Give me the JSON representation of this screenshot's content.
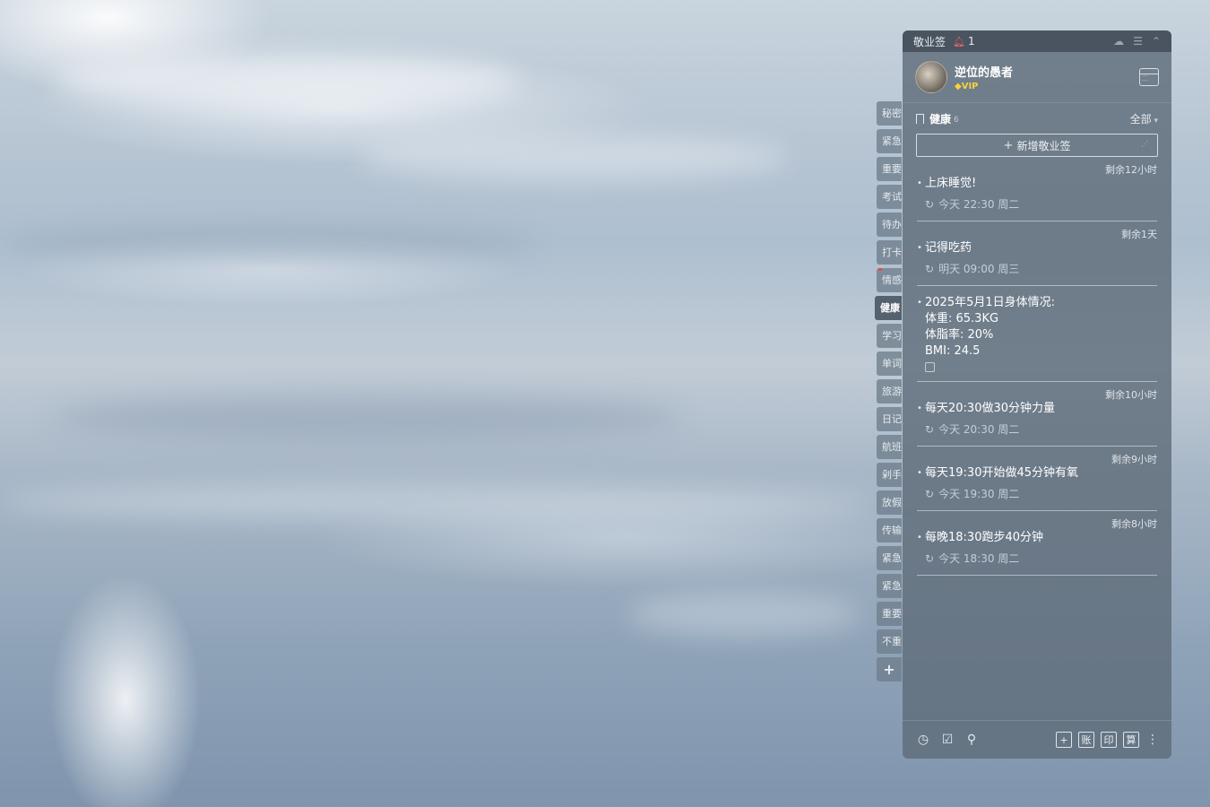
{
  "titlebar": {
    "app_name": "敬业签",
    "notify_count": "1",
    "icons": [
      "cloud-icon",
      "menu-icon",
      "collapse-icon"
    ]
  },
  "profile": {
    "username": "逆位的愚者",
    "vip_label": "VIP"
  },
  "tags": [
    {
      "label": "秘密"
    },
    {
      "label": "紧急"
    },
    {
      "label": "重要"
    },
    {
      "label": "考试"
    },
    {
      "label": "待办"
    },
    {
      "label": "打卡"
    },
    {
      "label": "情感"
    },
    {
      "label": "健康"
    },
    {
      "label": "学习"
    },
    {
      "label": "单词"
    },
    {
      "label": "旅游"
    },
    {
      "label": "日记"
    },
    {
      "label": "航班"
    },
    {
      "label": "剁手"
    },
    {
      "label": "放假"
    },
    {
      "label": "传输"
    },
    {
      "label": "紧急"
    },
    {
      "label": "紧急"
    },
    {
      "label": "重要"
    },
    {
      "label": "不重"
    }
  ],
  "add_tag_label": "+",
  "category": {
    "title": "健康",
    "count": "6",
    "filter": "全部"
  },
  "new_note_label": "新增敬业签",
  "notes": [
    {
      "remain": "剩余12小时",
      "text": "上床睡觉!",
      "time": "今天 22:30 周二"
    },
    {
      "remain": "剩余1天",
      "text": "记得吃药",
      "time": "明天 09:00 周三"
    },
    {
      "remain": "",
      "text": "2025年5月1日身体情况:\n体重: 65.3KG\n体脂率: 20%\nBMI: 24.5",
      "time": ""
    },
    {
      "remain": "剩余10小时",
      "text": "每天20:30做30分钟力量",
      "time": "今天 20:30 周二"
    },
    {
      "remain": "剩余9小时",
      "text": "每天19:30开始做45分钟有氧",
      "time": "今天 19:30 周二"
    },
    {
      "remain": "剩余8小时",
      "text": "每晚18:30跑步40分钟",
      "time": "今天 18:30 周二"
    }
  ],
  "bottom": {
    "left_icons": [
      "clock-icon",
      "calendar-check-icon",
      "search-icon"
    ],
    "buttons": [
      "+",
      "账",
      "印",
      "算"
    ]
  }
}
